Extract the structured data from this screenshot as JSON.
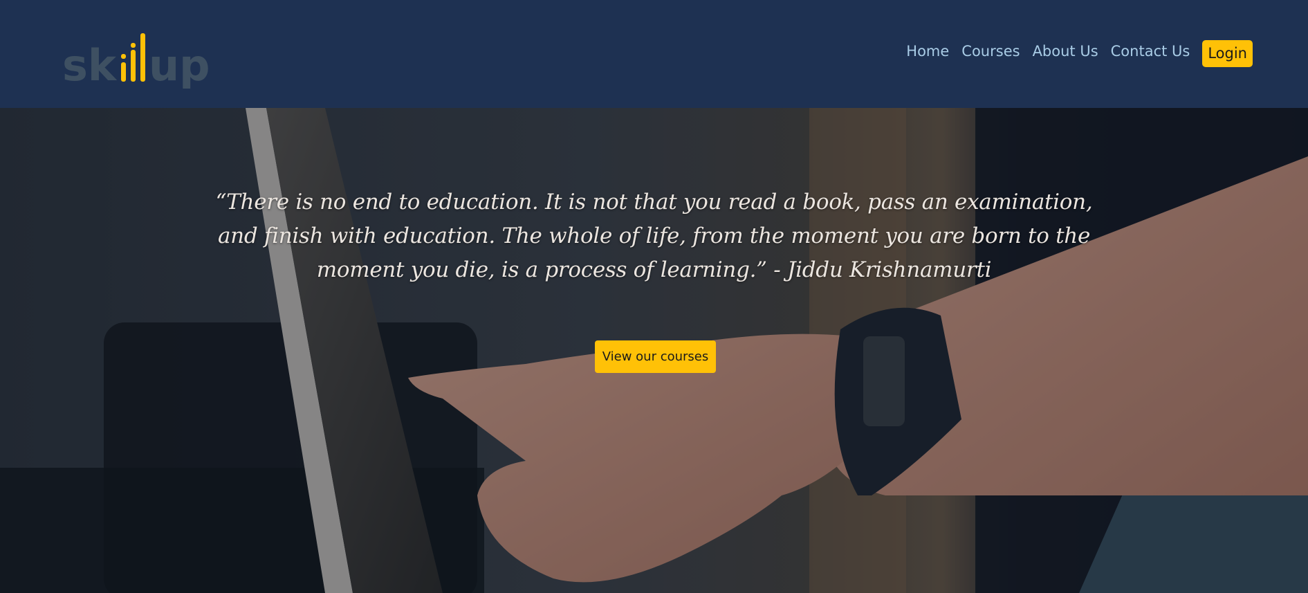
{
  "brand": {
    "logo_text": "skillup",
    "colors": {
      "navbar_bg": "#1e3152",
      "logo_gray": "#3e5062",
      "accent_yellow": "#ffc107",
      "nav_link": "#a9cce6"
    }
  },
  "nav": {
    "items": [
      {
        "label": "Home"
      },
      {
        "label": "Courses"
      },
      {
        "label": "About Us"
      },
      {
        "label": "Contact Us"
      }
    ],
    "login_label": "Login"
  },
  "hero": {
    "quote": "“There is no end to education. It is not that you read a book, pass an examination, and finish with education. The whole of life, from the moment you are born to the moment you die, is a process of learning.” - Jiddu Krishnamurti",
    "cta_label": "View our courses"
  }
}
